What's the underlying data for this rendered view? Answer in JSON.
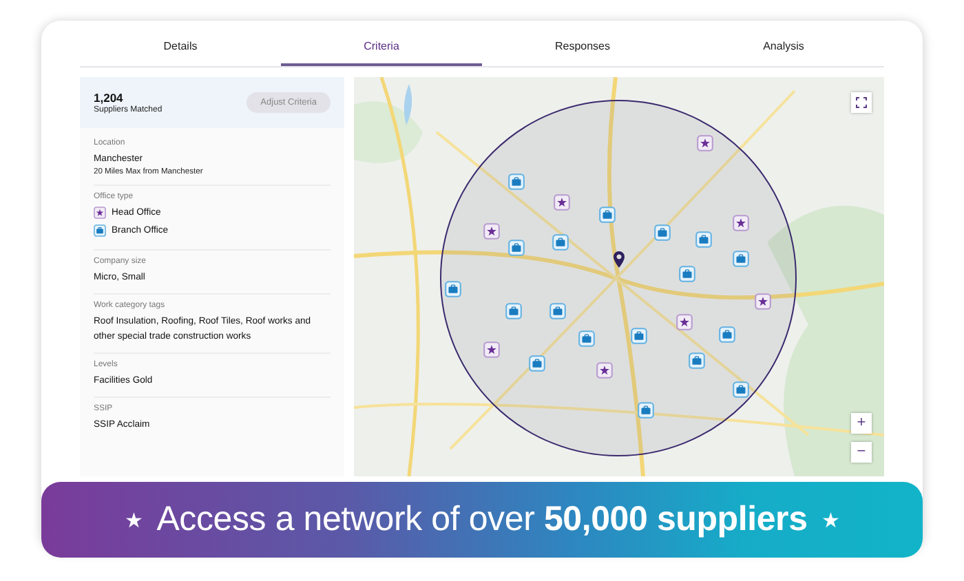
{
  "tabs": [
    {
      "label": "Details",
      "selected": false
    },
    {
      "label": "Criteria",
      "selected": true
    },
    {
      "label": "Responses",
      "selected": false
    },
    {
      "label": "Analysis",
      "selected": false
    }
  ],
  "summary": {
    "count": "1,204",
    "caption": "Suppliers Matched",
    "button": "Adjust Criteria"
  },
  "criteria": [
    {
      "kind": "text",
      "label": "Location",
      "value": "Manchester",
      "note": "20 Miles Max from Manchester"
    },
    {
      "kind": "legend",
      "label": "Office type",
      "items": [
        {
          "kind": "head",
          "text": "Head Office"
        },
        {
          "kind": "branch",
          "text": "Branch Office"
        }
      ]
    },
    {
      "kind": "text",
      "label": "Company size",
      "value": "Micro, Small"
    },
    {
      "kind": "text",
      "label": "Work category tags",
      "value": "Roof Insulation,  Roofing, Roof Tiles, Roof works and other special trade construction works"
    },
    {
      "kind": "text",
      "label": "Levels",
      "value": "Facilities Gold"
    },
    {
      "kind": "text",
      "label": "SSIP",
      "value": "SSIP Acclaim"
    }
  ],
  "map": {
    "kind": "picture",
    "markers": [
      {
        "kind": "head"
      },
      {
        "kind": "head"
      },
      {
        "kind": "head"
      },
      {
        "kind": "head"
      },
      {
        "kind": "head"
      },
      {
        "kind": "head"
      },
      {
        "kind": "head"
      },
      {
        "kind": "head"
      },
      {
        "kind": "branch"
      },
      {
        "kind": "branch"
      },
      {
        "kind": "branch"
      },
      {
        "kind": "branch"
      },
      {
        "kind": "branch"
      },
      {
        "kind": "branch"
      },
      {
        "kind": "branch"
      },
      {
        "kind": "branch"
      },
      {
        "kind": "branch"
      },
      {
        "kind": "branch"
      },
      {
        "kind": "branch"
      },
      {
        "kind": "branch"
      },
      {
        "kind": "branch"
      },
      {
        "kind": "branch"
      },
      {
        "kind": "branch"
      },
      {
        "kind": "branch"
      },
      {
        "kind": "branch"
      },
      {
        "kind": "branch"
      }
    ],
    "zoom_in": "+",
    "zoom_out": "−"
  },
  "banner": {
    "star_left": "★",
    "text": "Access a network of over **50,000 suppliers**",
    "star_right": "★"
  }
}
